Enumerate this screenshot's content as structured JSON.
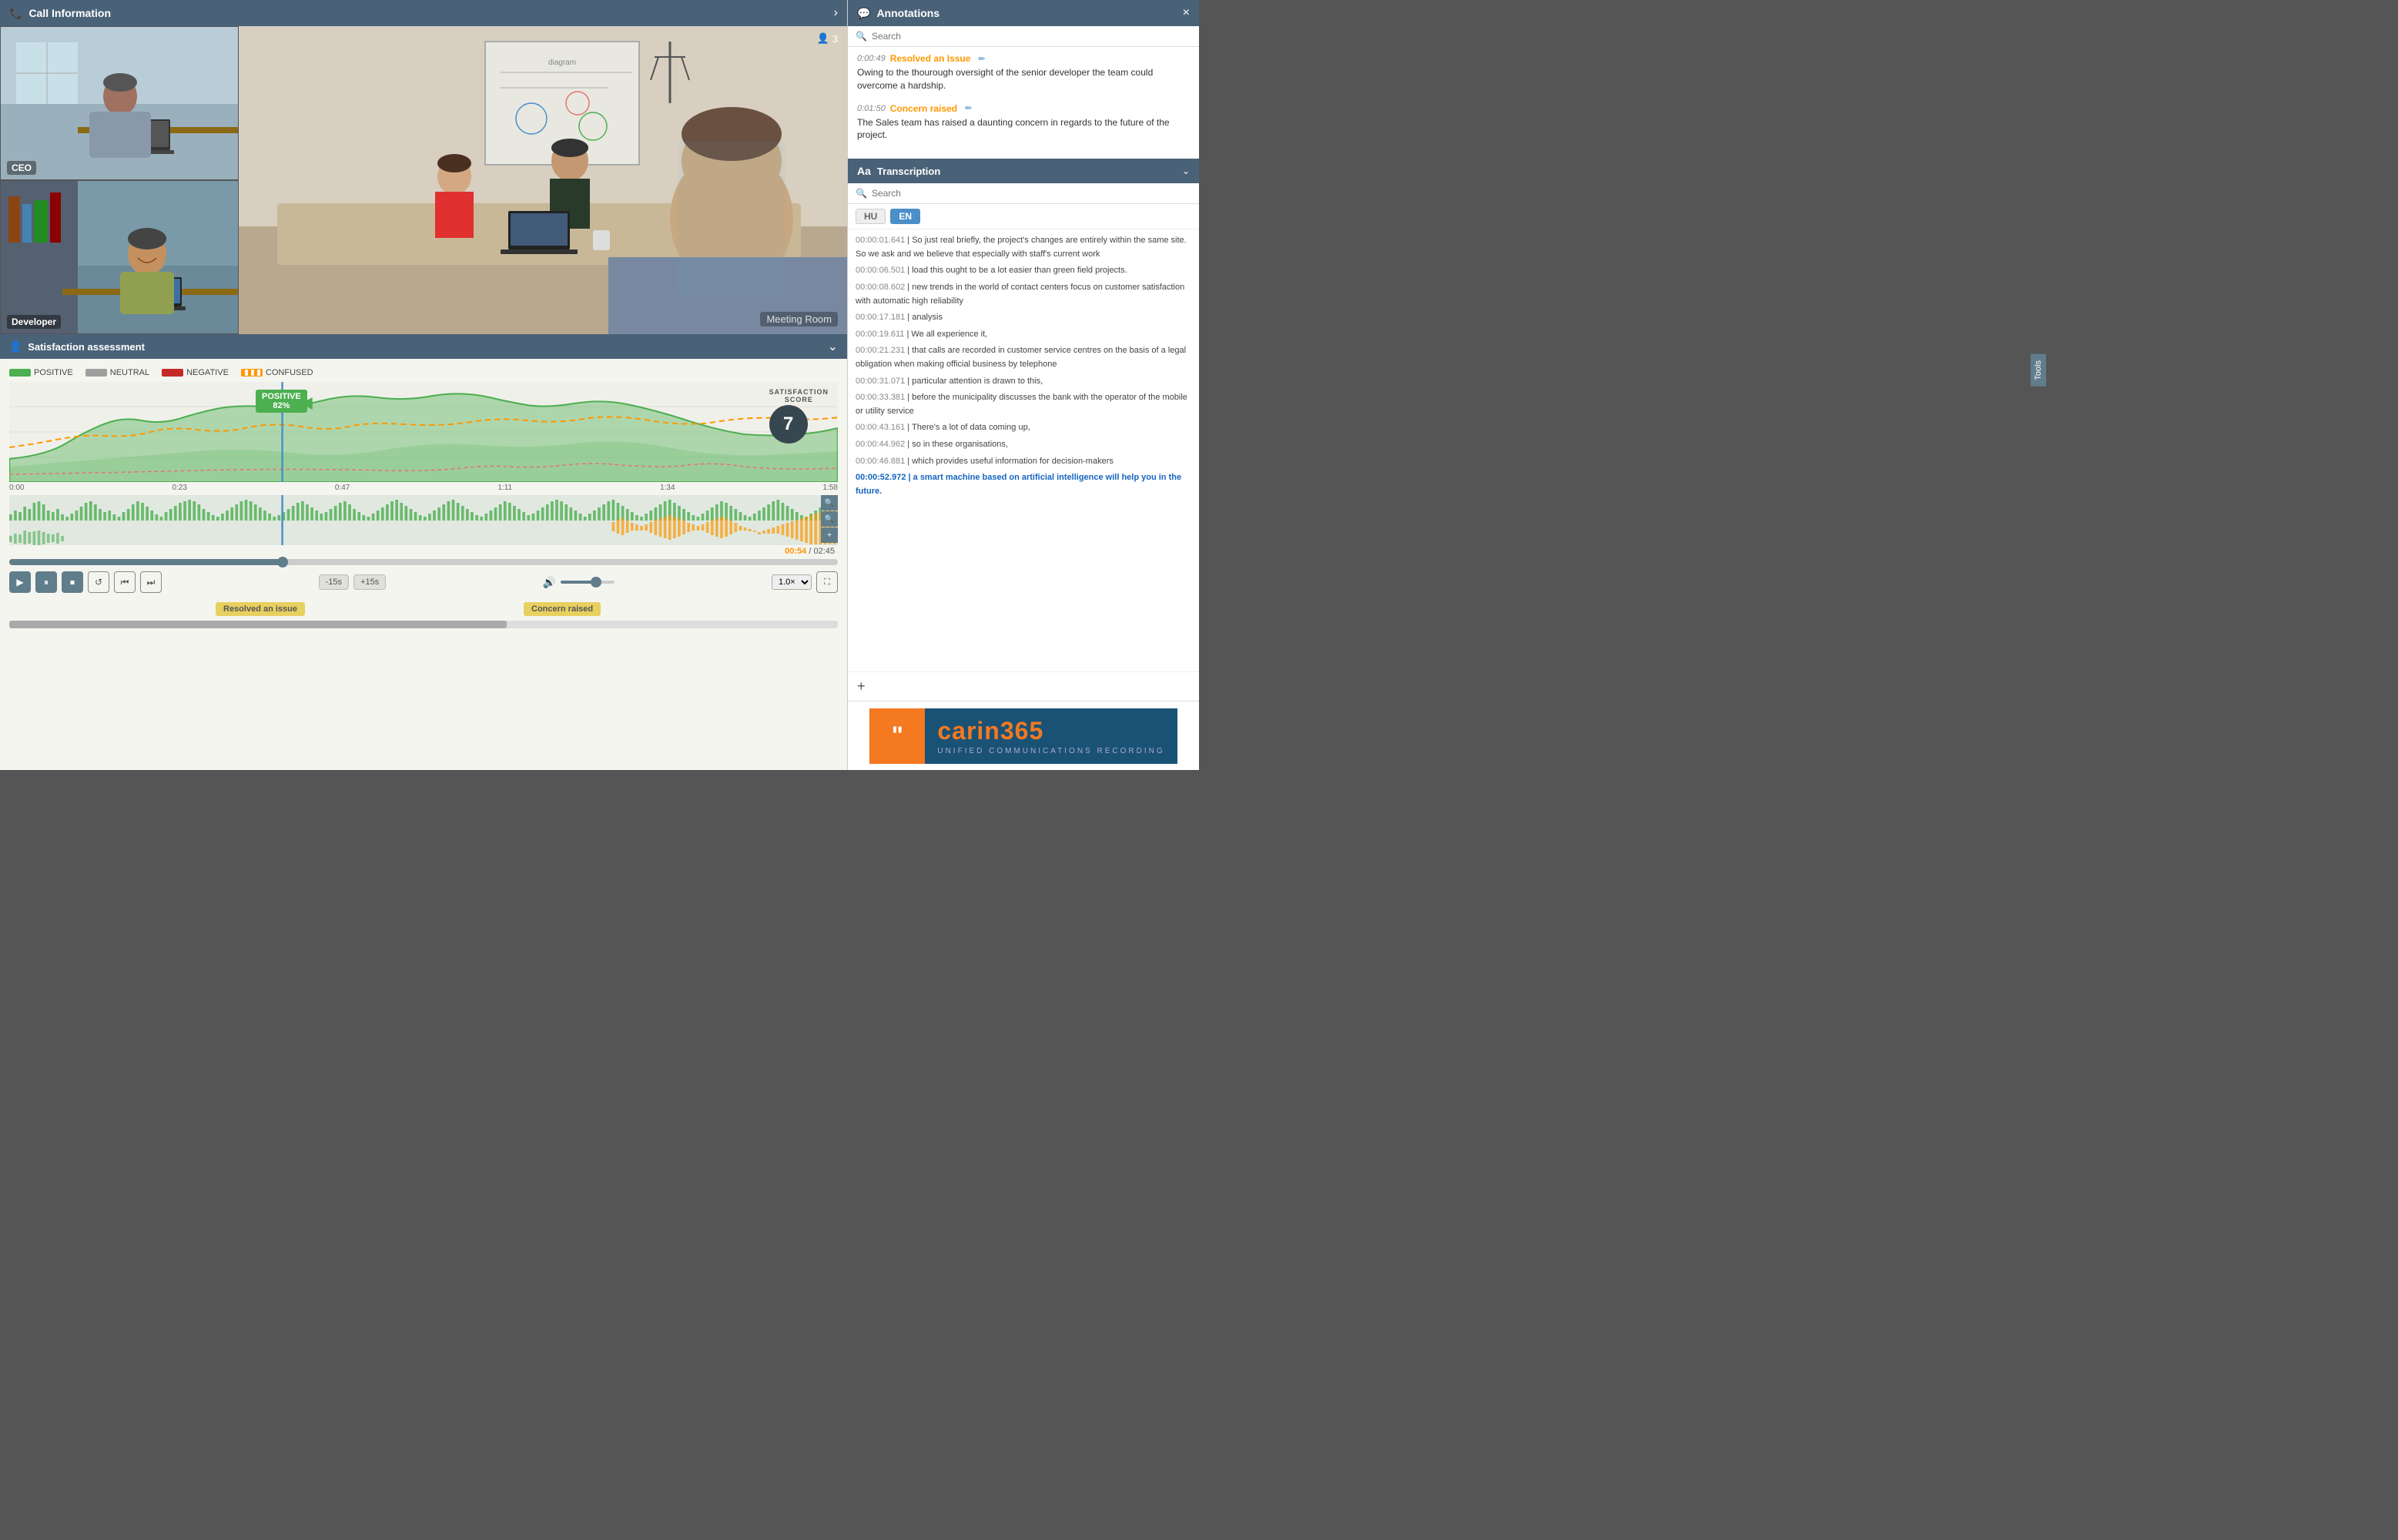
{
  "header": {
    "call_info_title": "Call Information",
    "chevron": "›"
  },
  "video": {
    "participants": "3",
    "ceo_label": "CEO",
    "developer_label": "Developer",
    "meeting_room_label": "Meeting Room"
  },
  "satisfaction": {
    "title": "Satisfaction assessment",
    "legend": {
      "positive": "POSITIVE",
      "neutral": "NEUTRAL",
      "negative": "NEGATIVE",
      "confused": "CONFUSED"
    },
    "tooltip_label": "POSITIVE",
    "tooltip_value": "82%",
    "score_label": "SATISFACTION SCORE",
    "score_value": "7",
    "timeline": [
      "0:00",
      "0:23",
      "0:47",
      "1:11",
      "1:34",
      "1:58"
    ],
    "time_current": "00:54",
    "time_total": "02:45"
  },
  "controls": {
    "play": "▶",
    "pause": "⏸",
    "stop": "⏹",
    "replay": "↺",
    "rewind": "⏮",
    "forward": "⏭",
    "skip_back": "-15s",
    "skip_forward": "+15s",
    "volume_icon": "🔊",
    "speed": "1.0×",
    "fullscreen": "⛶"
  },
  "annotations_markers": {
    "resolved": "Resolved an issue",
    "concern": "Concern raised"
  },
  "right_panel": {
    "annotations": {
      "title": "Annotations",
      "search_placeholder": "Search",
      "items": [
        {
          "time": "0:00:49",
          "type": "Resolved an Issue",
          "text": "Owing to the thourough oversight of the senior developer the team could overcome a hardship."
        },
        {
          "time": "0:01:50",
          "type": "Concern raised",
          "text": "The Sales team has raised a daunting concern in regards to the future of the project."
        }
      ]
    },
    "transcription": {
      "title": "Transcription",
      "search_placeholder": "Search",
      "lang_hu": "HU",
      "lang_en": "EN",
      "lines": [
        {
          "time": "00:00:01.641",
          "text": "So just real briefly, the project's changes are entirely within the same site. So we ask and we believe that especially with staff's current work",
          "highlight": false
        },
        {
          "time": "00:00:06.501",
          "text": "load this ought to be a lot easier than green field projects.",
          "highlight": false
        },
        {
          "time": "00:00:08.602",
          "text": "new trends in the world of contact centers focus on customer satisfaction with automatic high reliability",
          "highlight": false
        },
        {
          "time": "00:00:17.181",
          "text": "analysis",
          "highlight": false
        },
        {
          "time": "00:00:19.611",
          "text": "We all experience it,",
          "highlight": false
        },
        {
          "time": "00:00:21.231",
          "text": "that calls are recorded in customer service centres on the basis of a legal obligation when making official business by telephone",
          "highlight": false
        },
        {
          "time": "00:00:31.071",
          "text": "particular attention is drawn to this,",
          "highlight": false
        },
        {
          "time": "00:00:33.381",
          "text": "before the municipality discusses the bank with the operator of the mobile or utility service",
          "highlight": false
        },
        {
          "time": "00:00:43.161",
          "text": "There's a lot of data coming up,",
          "highlight": false
        },
        {
          "time": "00:00:44.962",
          "text": "so in these organisations,",
          "highlight": false
        },
        {
          "time": "00:00:46.881",
          "text": "which provides useful information for decision-makers",
          "highlight": false
        },
        {
          "time": "00:00:52.972",
          "text": "a smart machine based on artificial intelligence will help you in the future.",
          "highlight": true
        }
      ]
    },
    "brand": {
      "icon_text": "❝",
      "name_part1": "carin",
      "name_part2": "365",
      "tagline": "UNIFIED   COMMUNICATIONS   RECORDING"
    }
  }
}
